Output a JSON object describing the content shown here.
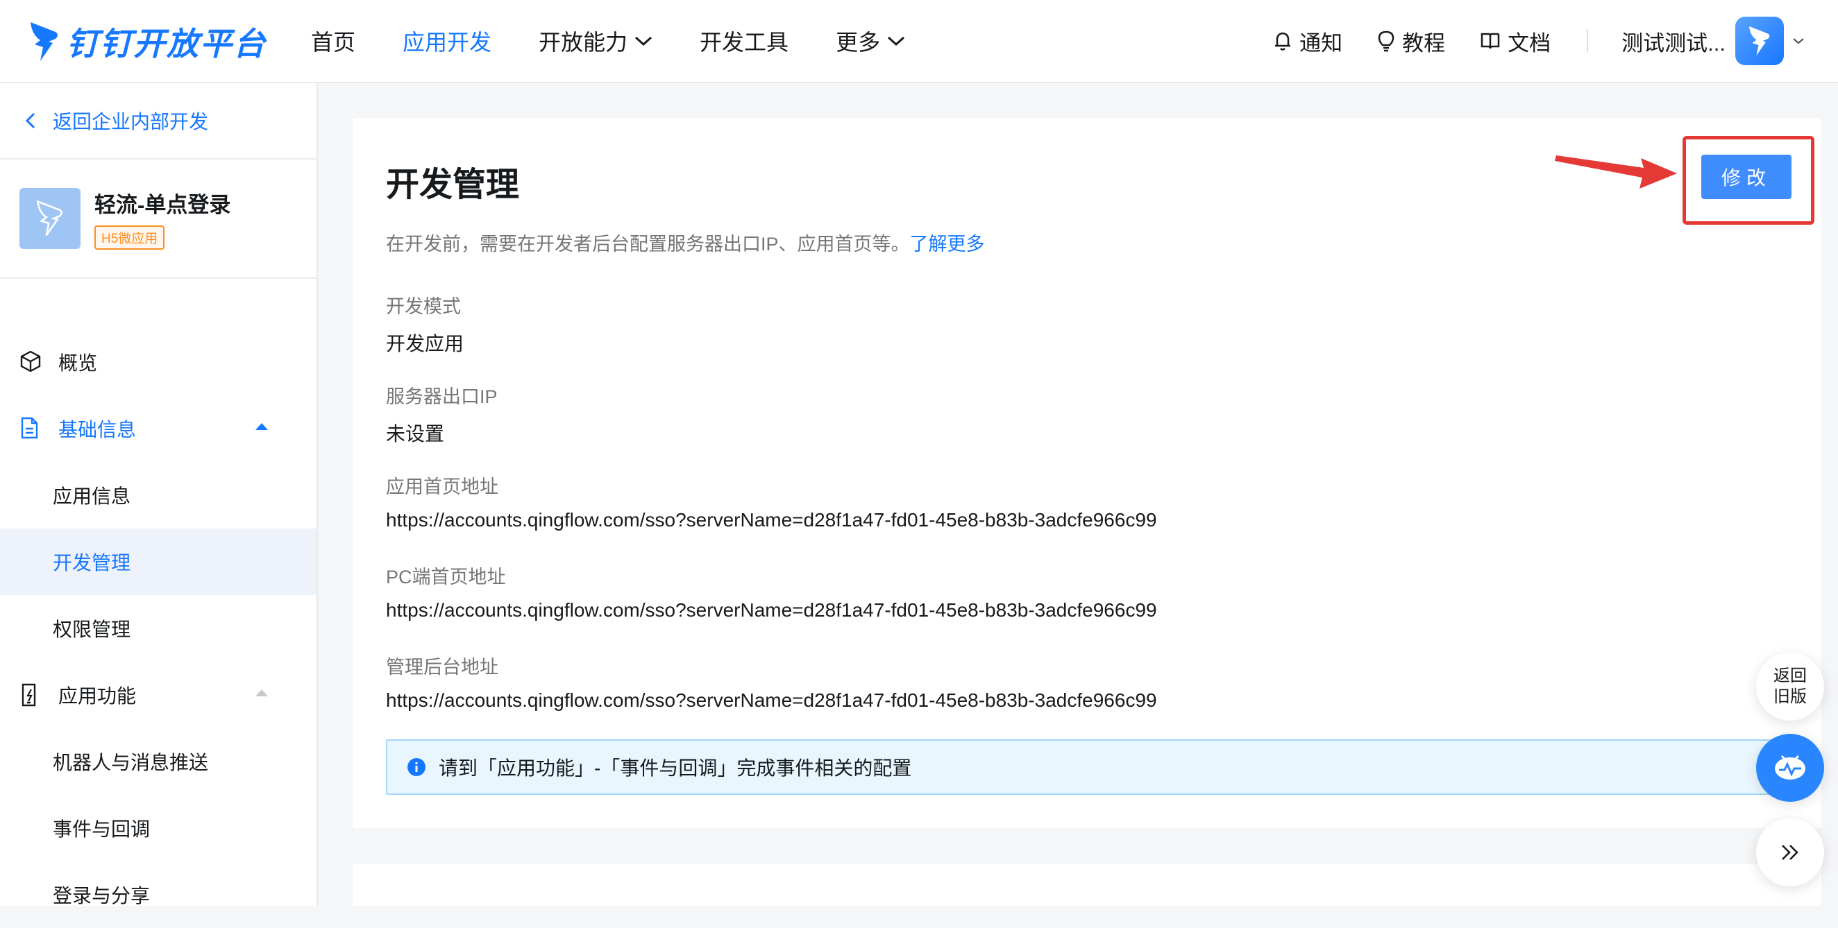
{
  "header": {
    "logo_text": "钉钉开放平台",
    "nav": [
      {
        "label": "首页",
        "active": false,
        "dropdown": false
      },
      {
        "label": "应用开发",
        "active": true,
        "dropdown": false
      },
      {
        "label": "开放能力",
        "active": false,
        "dropdown": true
      },
      {
        "label": "开发工具",
        "active": false,
        "dropdown": false
      },
      {
        "label": "更多",
        "active": false,
        "dropdown": true
      }
    ],
    "links": [
      {
        "label": "通知",
        "icon": "bell-icon"
      },
      {
        "label": "教程",
        "icon": "lightbulb-icon"
      },
      {
        "label": "文档",
        "icon": "book-icon"
      }
    ],
    "user_name": "测试测试...",
    "accent": "#1677ff"
  },
  "sidebar": {
    "back_label": "返回企业内部开发",
    "app_name": "轻流-单点登录",
    "app_tag": "H5微应用",
    "items": [
      {
        "label": "概览",
        "icon": "cube-icon",
        "kind": "top"
      },
      {
        "label": "基础信息",
        "icon": "document-icon",
        "kind": "group",
        "expanded": true
      },
      {
        "label": "应用信息",
        "kind": "sub"
      },
      {
        "label": "开发管理",
        "kind": "sub",
        "selected": true
      },
      {
        "label": "权限管理",
        "kind": "sub"
      },
      {
        "label": "应用功能",
        "icon": "phone-bolt-icon",
        "kind": "group",
        "expanded": true
      },
      {
        "label": "机器人与消息推送",
        "kind": "sub"
      },
      {
        "label": "事件与回调",
        "kind": "sub"
      },
      {
        "label": "登录与分享",
        "kind": "sub"
      }
    ]
  },
  "main": {
    "title": "开发管理",
    "description": "在开发前，需要在开发者后台配置服务器出口IP、应用首页等。",
    "learn_more": "了解更多",
    "edit_button": "修改",
    "fields": [
      {
        "label": "开发模式",
        "value": "开发应用"
      },
      {
        "label": "服务器出口IP",
        "value": "未设置"
      },
      {
        "label": "应用首页地址",
        "value": "https://accounts.qingflow.com/sso?serverName=d28f1a47-fd01-45e8-b83b-3adcfe966c99"
      },
      {
        "label": "PC端首页地址",
        "value": "https://accounts.qingflow.com/sso?serverName=d28f1a47-fd01-45e8-b83b-3adcfe966c99"
      },
      {
        "label": "管理后台地址",
        "value": "https://accounts.qingflow.com/sso?serverName=d28f1a47-fd01-45e8-b83b-3adcfe966c99"
      }
    ],
    "info_text": "请到「应用功能」-「事件与回调」完成事件相关的配置"
  },
  "floats": {
    "old_version_line1": "返回",
    "old_version_line2": "旧版"
  }
}
